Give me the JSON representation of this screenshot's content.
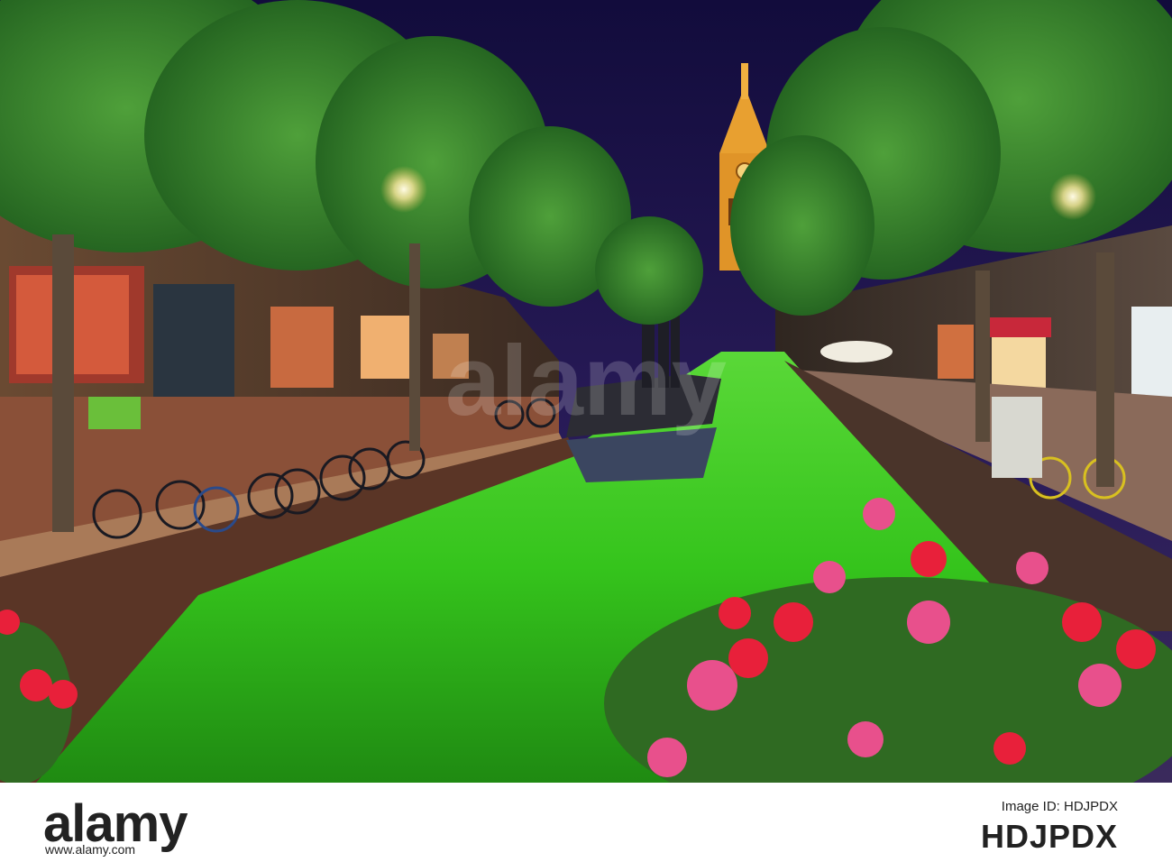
{
  "watermark": {
    "brand": "alamy"
  },
  "footer": {
    "logo": "alamy",
    "image_id_label": "Image ID: HDJPDX",
    "image_id": "HDJPDX",
    "url": "www.alamy.com"
  },
  "colors": {
    "sky": "#1a1450",
    "canal_water": "#2fbf1f",
    "tower": "#e0a030",
    "flowers_red": "#e8203a",
    "flowers_pink": "#e8508c"
  },
  "scene": {
    "description_icons": [
      "tree-icon",
      "bicycle-icon",
      "tower-icon",
      "flower-icon",
      "boat-icon"
    ]
  }
}
